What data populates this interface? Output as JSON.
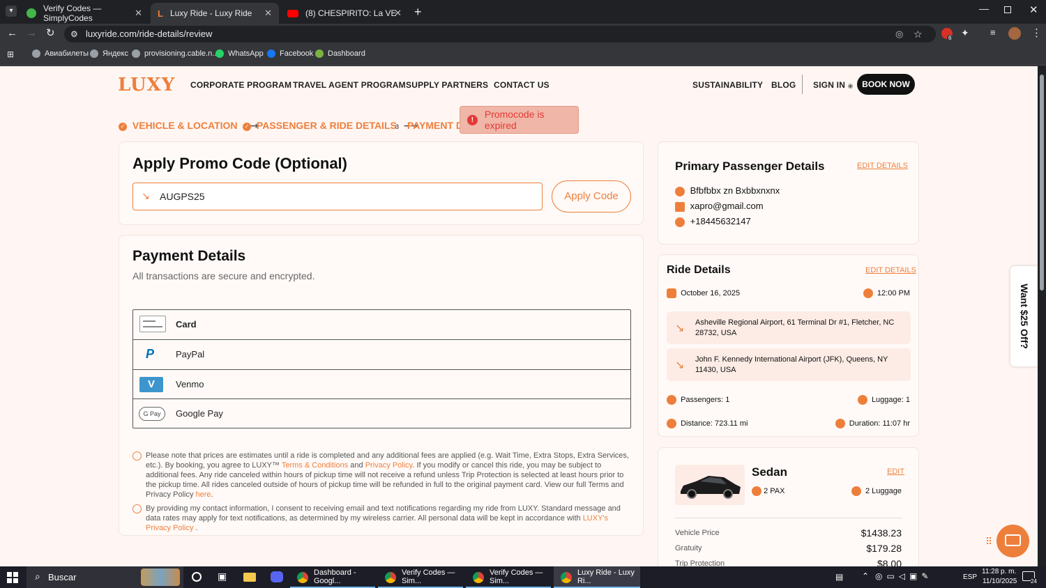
{
  "browser": {
    "tabs": [
      {
        "title": "Verify Codes — SimplyCodes"
      },
      {
        "title": "Luxy Ride - Luxy Ride"
      },
      {
        "title": "(8) CHESPIRITO: La VERDAD qu"
      }
    ],
    "url": "luxyride.com/ride-details/review",
    "bookmarks": [
      "Авиабилеты",
      "Яндекс",
      "provisioning.cable.n...",
      "WhatsApp",
      "Facebook",
      "Dashboard"
    ],
    "extension_badge": "6"
  },
  "header": {
    "logo": "LUXY",
    "nav": [
      "CORPORATE PROGRAM",
      "TRAVEL AGENT PROGRAM",
      "SUPPLY PARTNERS",
      "CONTACT US"
    ],
    "right_nav": [
      "SUSTAINABILITY",
      "BLOG"
    ],
    "sign_in": "SIGN IN",
    "book_now": "BOOK NOW"
  },
  "steps": [
    {
      "label": "VEHICLE & LOCATION"
    },
    {
      "label": "PASSENGER & RIDE DETAILS"
    },
    {
      "num": "3",
      "label": "PAYMENT D"
    }
  ],
  "toast": {
    "text": "Promocode is expired"
  },
  "promo": {
    "title": "Apply Promo Code (Optional)",
    "code": "AUGPS25",
    "apply": "Apply Code"
  },
  "payment": {
    "title": "Payment Details",
    "subtitle": "All transactions are secure and encrypted.",
    "methods": [
      "Card",
      "PayPal",
      "Venmo",
      "Google Pay"
    ],
    "venmo_mark": "V",
    "gpay_mark": "G Pay",
    "note1_a": "Please note that prices are estimates until a ride is completed and any additional fees are applied (e.g. Wait Time, Extra Stops, Extra Services, etc.). By booking, you agree to LUXY™ ",
    "terms": "Terms & Conditions",
    "and": " and ",
    "privacy": "Privacy Policy",
    "note1_b": ". If you modify or cancel this ride, you may be subject to additional fees. Any ride canceled within hours of pickup time will not receive a refund unless Trip Protection is selected at least hours prior to the pickup time. All rides canceled outside of hours of pickup time will be refunded in full to the original payment card. View our full Terms and Privacy Policy ",
    "here": "here",
    "note1_c": ".",
    "note2_a": "By providing my contact information, I consent to receiving email and text notifications regarding my ride from LUXY. Standard message and data rates may apply for text notifications, as determined by my wireless carrier. All personal data will be kept in accordance with ",
    "luxy_privacy": "LUXY's Privacy Policy",
    "note2_b": " ."
  },
  "passenger": {
    "title": "Primary Passenger Details",
    "edit": "EDIT DETAILS",
    "name": "Bfbfbbx zn Bxbbxnxnx",
    "email": "xapro@gmail.com",
    "phone": "+18445632147"
  },
  "ride": {
    "title": "Ride Details",
    "edit": "EDIT DETAILS",
    "date": "October 16, 2025",
    "time": "12:00 PM",
    "pickup": "Asheville Regional Airport, 61 Terminal Dr #1, Fletcher, NC 28732, USA",
    "dropoff": "John F. Kennedy International Airport (JFK), Queens, NY 11430, USA",
    "passengers": "Passengers: 1",
    "luggage": "Luggage: 1",
    "distance": "Distance: 723.11 mi",
    "duration": "Duration: 11:07 hr"
  },
  "vehicle": {
    "name": "Sedan",
    "edit": "EDIT",
    "pax": "2 PAX",
    "luggage": "2 Luggage",
    "prices": [
      {
        "label": "Vehicle Price",
        "value": "$1438.23"
      },
      {
        "label": "Gratuity",
        "value": "$179.28"
      },
      {
        "label": "Trip Protection",
        "value": "$8.00"
      }
    ]
  },
  "side_tab": "Want $25 Off?",
  "taskbar": {
    "search": "Buscar",
    "apps": [
      "Dashboard - Googl...",
      "Verify Codes — Sim...",
      "Verify Codes — Sim...",
      "Luxy Ride - Luxy Ri..."
    ],
    "lang": "ESP",
    "time": "11:28 p. m.",
    "date": "11/10/2025",
    "notif": "24"
  },
  "colors": {
    "accent": "#ee7f3b",
    "black_button": "#111111",
    "toast_bg": "#f0b6a8"
  }
}
